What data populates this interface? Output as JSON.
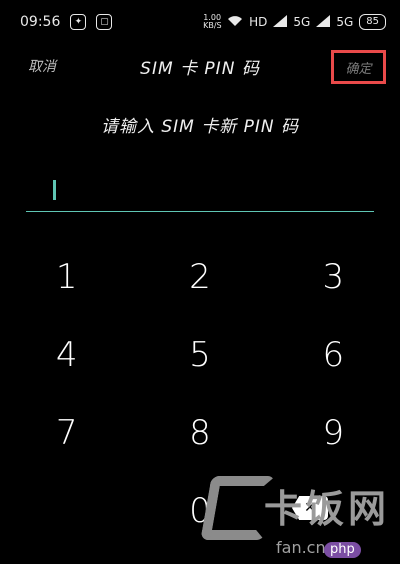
{
  "status_bar": {
    "time": "09:56",
    "speed_top": "1.00",
    "speed_bottom": "KB/S",
    "hd_label": "HD",
    "network_a": "5G",
    "network_b": "5G",
    "battery": "85"
  },
  "header": {
    "cancel_label": "取消",
    "title": "SIM 卡 PIN 码",
    "confirm_label": "确定"
  },
  "prompt": "请输入 SIM 卡新 PIN 码",
  "keypad": {
    "keys": [
      "1",
      "2",
      "3",
      "4",
      "5",
      "6",
      "7",
      "8",
      "9",
      "",
      "0",
      ""
    ]
  },
  "watermark": {
    "title": "卡饭网",
    "url": "fan.cn",
    "badge": "php"
  }
}
